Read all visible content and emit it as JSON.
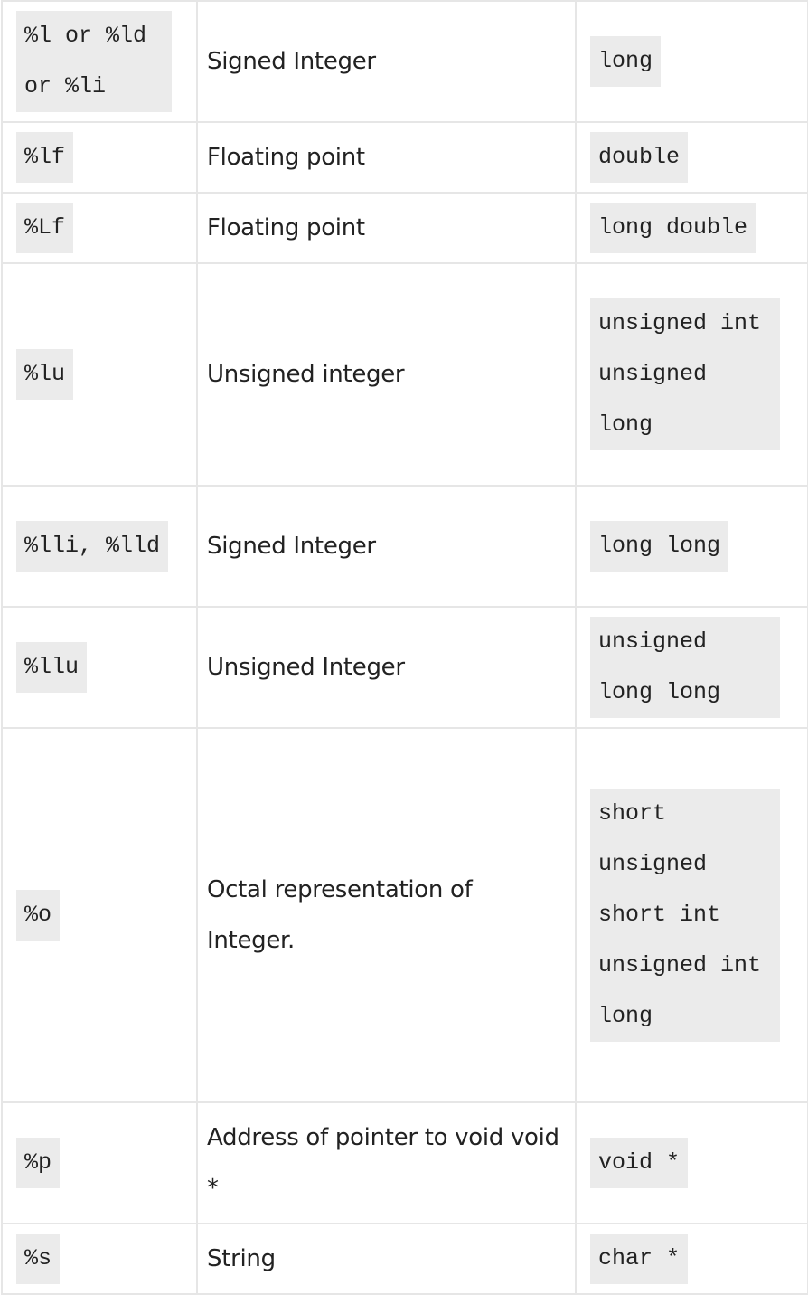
{
  "rows": [
    {
      "specifier": "%l or %ld or %li",
      "description": "Signed Integer",
      "type": "long"
    },
    {
      "specifier": "%lf",
      "description": "Floating point",
      "type": "double"
    },
    {
      "specifier": "%Lf",
      "description": "Floating point",
      "type": "long double"
    },
    {
      "specifier": "%lu",
      "description": "Unsigned integer",
      "type": "unsigned int unsigned long"
    },
    {
      "specifier": "%lli, %lld",
      "description": "Signed Integer",
      "type": "long long"
    },
    {
      "specifier": "%llu",
      "description": "Unsigned Integer",
      "type": "unsigned long long"
    },
    {
      "specifier": "%o",
      "description": "Octal representation of Integer.",
      "type": "short unsigned short int unsigned int long"
    },
    {
      "specifier": "%p",
      "description": "Address of pointer to void void *",
      "type": "void *"
    },
    {
      "specifier": "%s",
      "description": "String",
      "type": "char *"
    }
  ]
}
